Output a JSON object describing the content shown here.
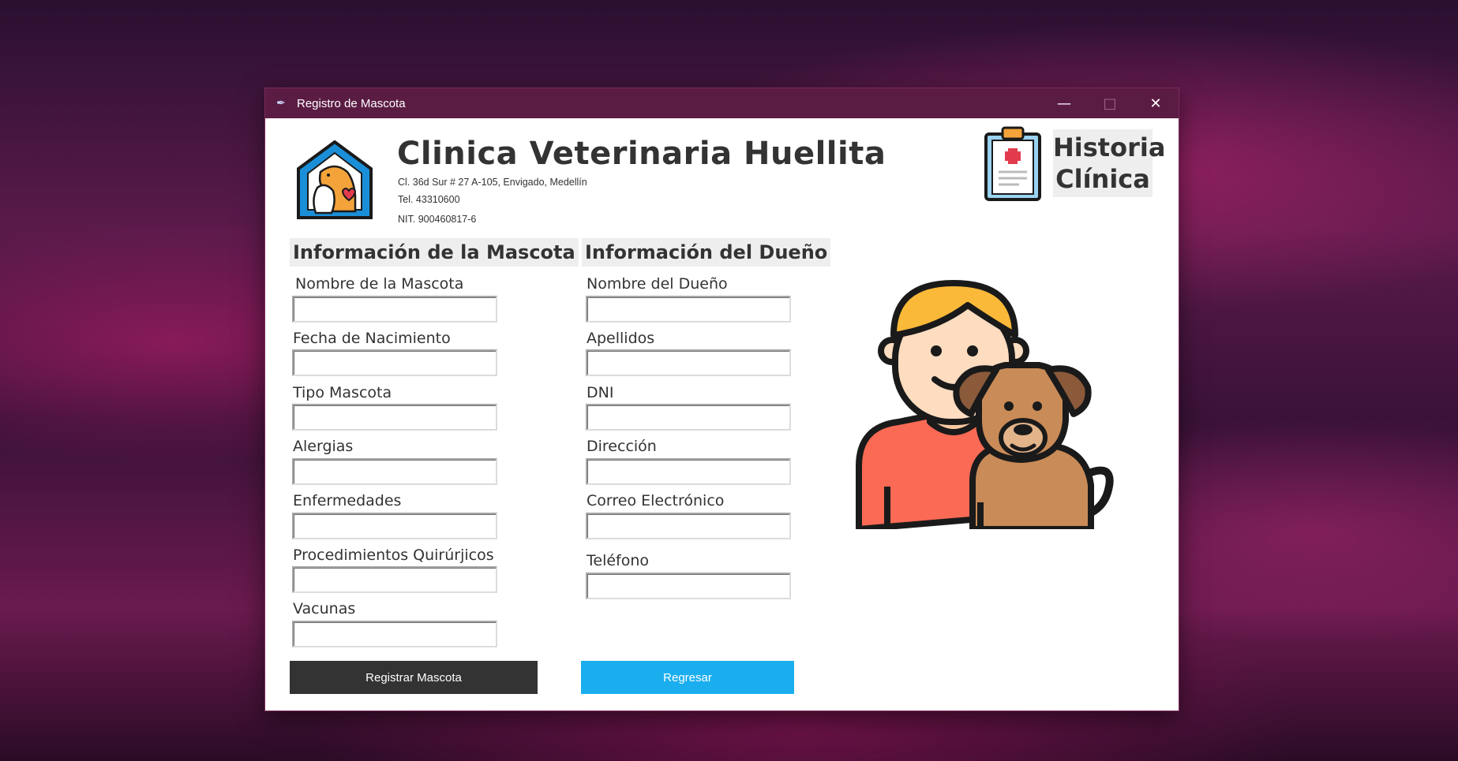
{
  "window": {
    "title": "Registro de Mascota",
    "controls": [
      "minimize",
      "maximize",
      "close"
    ]
  },
  "header": {
    "clinic_name": "Clinica Veterinaria Huellita",
    "address": "Cl. 36d Sur # 27 A-105, Envigado, Medellín",
    "phone": "Tel. 43310600",
    "nit": "NIT. 900460817-6",
    "history_line1": "Historia",
    "history_line2": "Clínica"
  },
  "pet_section": {
    "title": "Información de la Mascota",
    "fields": [
      {
        "label": "Nombre de la Mascota",
        "value": ""
      },
      {
        "label": "Fecha de Nacimiento",
        "value": ""
      },
      {
        "label": "Tipo Mascota",
        "value": ""
      },
      {
        "label": "Alergias",
        "value": ""
      },
      {
        "label": "Enfermedades",
        "value": ""
      },
      {
        "label": "Procedimientos Quirúrjicos",
        "value": ""
      },
      {
        "label": "Vacunas",
        "value": ""
      }
    ]
  },
  "owner_section": {
    "title": "Información del Dueño",
    "fields": [
      {
        "label": "Nombre del Dueño",
        "value": ""
      },
      {
        "label": "Apellidos",
        "value": ""
      },
      {
        "label": "DNI",
        "value": ""
      },
      {
        "label": "Dirección",
        "value": ""
      },
      {
        "label": "Correo Electrónico",
        "value": ""
      },
      {
        "label": "Teléfono",
        "value": ""
      }
    ]
  },
  "buttons": {
    "register": "Registrar Mascota",
    "back": "Regresar"
  },
  "colors": {
    "titlebar": "#5b1c44",
    "register_button": "#333333",
    "back_button": "#1aaeef"
  }
}
